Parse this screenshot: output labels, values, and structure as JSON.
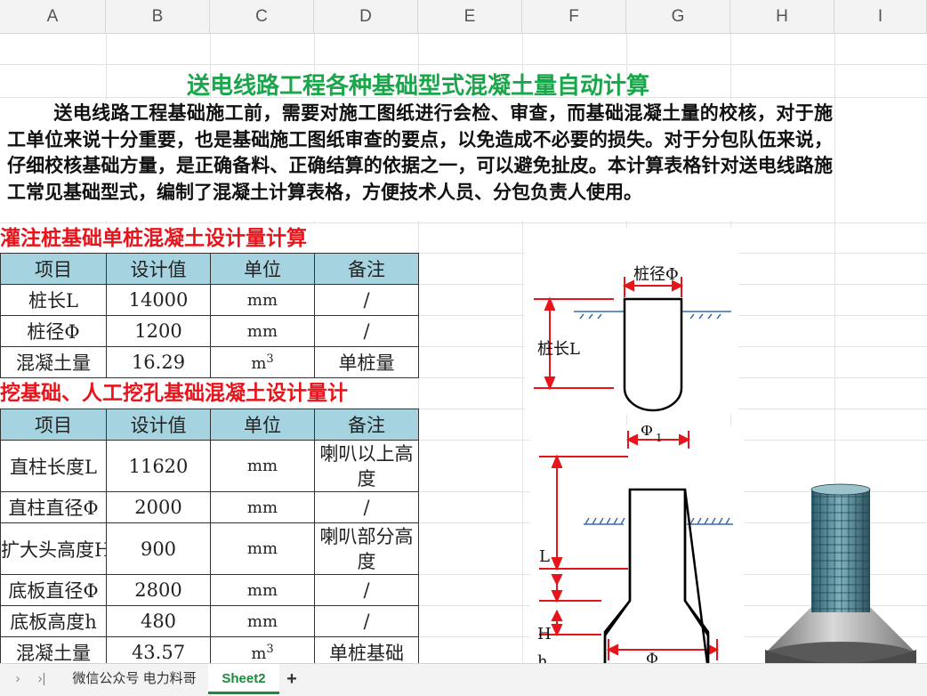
{
  "columns": [
    "A",
    "B",
    "C",
    "D",
    "E",
    "F",
    "G",
    "H",
    "I"
  ],
  "title": "送电线路工程各种基础型式混凝土量自动计算",
  "intro": "送电线路工程基础施工前，需要对施工图纸进行会检、审查，而基础混凝土量的校核，对于施工单位来说十分重要，也是基础施工图纸审查的要点，以免造成不必要的损失。对于分包队伍来说，仔细校核基础方量，是正确备料、正确结算的依据之一，可以避免扯皮。本计算表格针对送电线路施工常见基础型式，编制了混凝土计算表格，方便技术人员、分包负责人使用。",
  "section1": {
    "title": "灌注桩基础单桩混凝土设计量计算",
    "headers": [
      "项目",
      "设计值",
      "单位",
      "备注"
    ],
    "rows": [
      {
        "item": "桩长L",
        "value": "14000",
        "unit": "mm",
        "note": "/"
      },
      {
        "item": "桩径Φ",
        "value": "1200",
        "unit": "mm",
        "note": "/"
      },
      {
        "item": "混凝土量",
        "value": "16.29",
        "unit": "m",
        "unit_sup": "3",
        "note": "单桩量"
      }
    ]
  },
  "section2": {
    "title": "挖基础、人工挖孔基础混凝土设计量计",
    "headers": [
      "项目",
      "设计值",
      "单位",
      "备注"
    ],
    "rows": [
      {
        "item": "直柱长度L",
        "value": "11620",
        "unit": "mm",
        "note": "喇叭以上高度"
      },
      {
        "item": "直柱直径Φ",
        "value": "2000",
        "unit": "mm",
        "note": "/"
      },
      {
        "item": "扩大头高度H",
        "value": "900",
        "unit": "mm",
        "note": "喇叭部分高度"
      },
      {
        "item": "底板直径Φ",
        "value": "2800",
        "unit": "mm",
        "note": "/"
      },
      {
        "item": "底板高度h",
        "value": "480",
        "unit": "mm",
        "note": "/"
      },
      {
        "item": "混凝土量",
        "value": "43.57",
        "unit": "m",
        "unit_sup": "3",
        "note": "单桩基础"
      }
    ]
  },
  "diagram1": {
    "diameter_label": "桩径Φ",
    "length_label": "桩长L"
  },
  "diagram2": {
    "top_label": "Φ",
    "top_sub": "1",
    "l_label": "L",
    "h_label": "H",
    "h2_label": "h",
    "bottom_label": "Φ"
  },
  "tabs": {
    "nav_prev": "›",
    "nav_last": "›|",
    "sheet1": "微信公众号 电力料哥",
    "sheet2": "Sheet2",
    "add": "+"
  },
  "colors": {
    "title": "#1aa64a",
    "section": "#e8141b",
    "header_fill": "#a6d3e0",
    "dim": "#e8141b",
    "active_tab": "#1b8a3a"
  }
}
